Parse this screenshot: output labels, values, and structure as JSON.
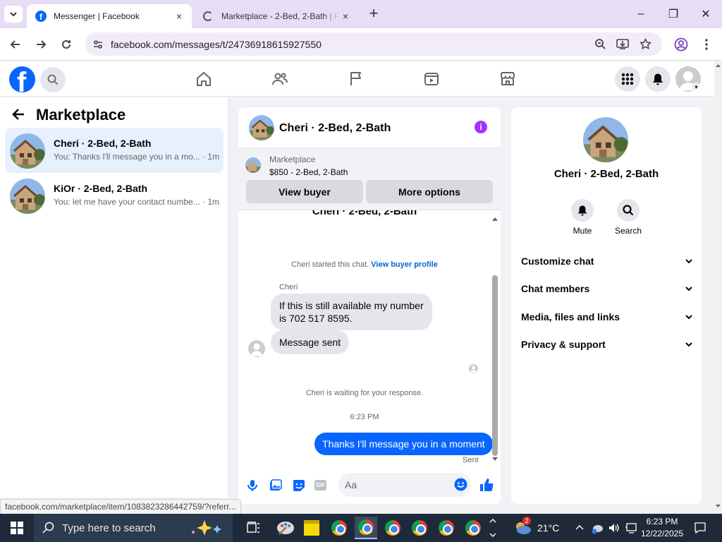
{
  "browser": {
    "tabs": [
      {
        "title": "Messenger | Facebook",
        "close": "×"
      },
      {
        "title": "Marketplace - 2-Bed, 2-Bath | F",
        "close": "×"
      }
    ],
    "new_tab": "+",
    "window_controls": {
      "minimize": "–",
      "restore": "❐",
      "close": "✕"
    },
    "url": "facebook.com/messages/t/24736918615927550",
    "status_url": "facebook.com/marketplace/item/1083823286442759/?referr..."
  },
  "left_panel": {
    "title": "Marketplace",
    "conversations": [
      {
        "name": "Cheri · 2-Bed, 2-Bath",
        "preview": "You: Thanks I'll message you in a mo...",
        "time": "· 1m"
      },
      {
        "name": "KiOr · 2-Bed, 2-Bath",
        "preview": "You: let me have your contact numbe...",
        "time": "· 1m"
      }
    ]
  },
  "chat": {
    "title": "Cheri · 2-Bed, 2-Bath",
    "listing": {
      "label": "Marketplace",
      "detail": "$850 - 2-Bed, 2-Bath"
    },
    "view_buyer": "View buyer",
    "more_options": "More options",
    "scrolled_title": "Cheri · 2-Bed, 2-Bath",
    "started_text": "Cheri started this chat.",
    "view_buyer_profile": "View buyer profile",
    "sender_name": "Cheri",
    "msg1": "If this is still available my number is 702 517 8595.",
    "msg2": "Message sent",
    "waiting": "Cheri is waiting for your response.",
    "time": "6:23 PM",
    "my_msg": "Thanks I'll message you in a moment",
    "sent": "Sent",
    "input_placeholder": "Aa"
  },
  "right_panel": {
    "name": "Cheri · 2-Bed, 2-Bath",
    "mute": "Mute",
    "search": "Search",
    "sections": [
      "Customize chat",
      "Chat members",
      "Media, files and links",
      "Privacy & support"
    ]
  },
  "taskbar": {
    "search_placeholder": "Type here to search",
    "weather": "21°C",
    "weather_badge": "2",
    "time": "6:23 PM",
    "date": "12/22/2025"
  },
  "colors": {
    "facebook_blue": "#0866ff",
    "messenger_purple": "#a033ff",
    "link_blue": "#0064d1"
  }
}
